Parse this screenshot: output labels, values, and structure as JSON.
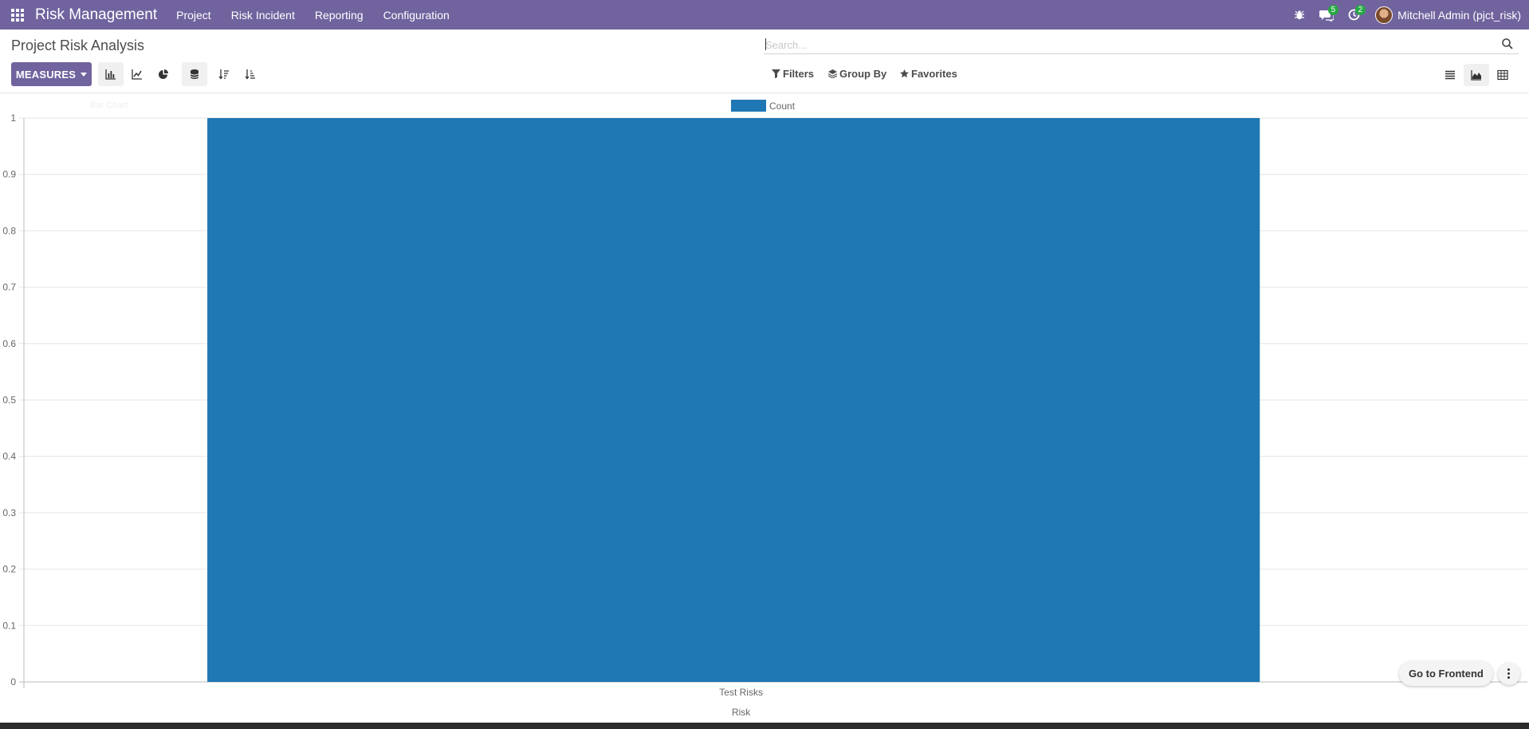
{
  "navbar": {
    "brand": "Risk Management",
    "menu": [
      "Project",
      "Risk Incident",
      "Reporting",
      "Configuration"
    ],
    "messages_count": "5",
    "activities_count": "2",
    "user_name": "Mitchell Admin (pjct_risk)"
  },
  "page": {
    "title": "Project Risk Analysis"
  },
  "search": {
    "placeholder": "Search..."
  },
  "toolbar": {
    "measures_label": "MEASURES",
    "filters_label": "Filters",
    "groupby_label": "Group By",
    "favorites_label": "Favorites"
  },
  "chart": {
    "faded_title": "Bar Chart",
    "legend_label": "Count",
    "bar_color": "#1f77b4"
  },
  "chart_data": {
    "type": "bar",
    "categories": [
      "Test Risks"
    ],
    "series": [
      {
        "name": "Count",
        "values": [
          1
        ]
      }
    ],
    "xlabel": "Risk",
    "ylabel": "",
    "ylim": [
      0,
      1
    ],
    "yticks": [
      "0",
      "0.1",
      "0.2",
      "0.3",
      "0.4",
      "0.5",
      "0.6",
      "0.7",
      "0.8",
      "0.9",
      "1"
    ],
    "grid": true,
    "legend": "top-center"
  },
  "footer": {
    "go_to_frontend": "Go to Frontend"
  },
  "colors": {
    "navbar": "#71639e",
    "primary_button": "#71639e",
    "badge": "#28a745"
  }
}
